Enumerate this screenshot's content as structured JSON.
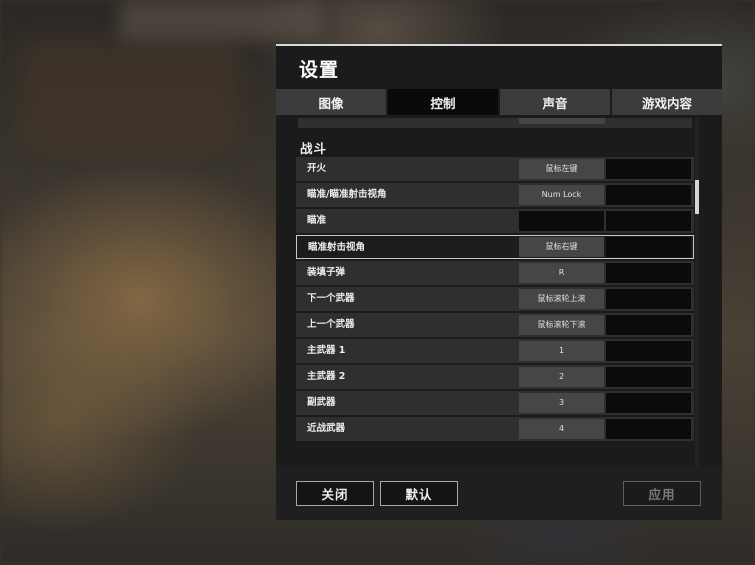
{
  "settings": {
    "title": "设置",
    "tabs": [
      "图像",
      "控制",
      "声音",
      "游戏内容"
    ],
    "active_tab": "控制",
    "section_title": "战斗",
    "rows": [
      {
        "label": "开火",
        "key1": "鼠标左键",
        "key2": ""
      },
      {
        "label": "瞄准/瞄准射击视角",
        "key1": "Num Lock",
        "key2": ""
      },
      {
        "label": "瞄准",
        "key1": "",
        "key2": ""
      },
      {
        "label": "瞄准射击视角",
        "key1": "鼠标右键",
        "key2": "",
        "selected": true
      },
      {
        "label": "装填子弹",
        "key1": "R",
        "key2": ""
      },
      {
        "label": "下一个武器",
        "key1": "鼠标滚轮上滚",
        "key2": ""
      },
      {
        "label": "上一个武器",
        "key1": "鼠标滚轮下滚",
        "key2": ""
      },
      {
        "label": "主武器 1",
        "key1": "1",
        "key2": ""
      },
      {
        "label": "主武器 2",
        "key1": "2",
        "key2": ""
      },
      {
        "label": "副武器",
        "key1": "3",
        "key2": ""
      },
      {
        "label": "近战武器",
        "key1": "4",
        "key2": ""
      }
    ],
    "buttons": {
      "close": "关闭",
      "default": "默认",
      "apply": "应用"
    }
  },
  "colors": {
    "panel_bg": "#1b1b1b",
    "row_bg": "#2f2f2f",
    "key_bg": "#464646",
    "selected_border": "#c8c8c8",
    "apply_disabled": "#7a7a7a"
  }
}
